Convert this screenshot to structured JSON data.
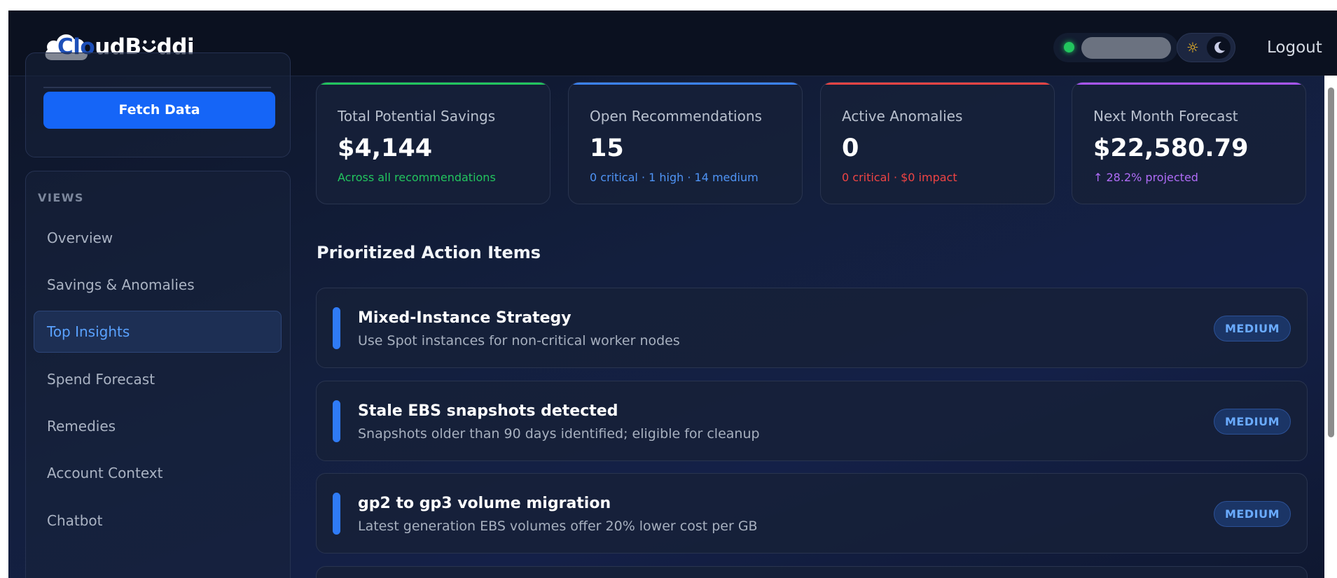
{
  "header": {
    "brand_prefix": "Clo",
    "brand_suffix": "udB",
    "brand_end": "ddi",
    "logout_label": "Logout"
  },
  "sidebar": {
    "fetch_label": "Fetch Data",
    "views_label": "VIEWS",
    "items": [
      {
        "label": "Overview",
        "active": false
      },
      {
        "label": "Savings & Anomalies",
        "active": false
      },
      {
        "label": "Top Insights",
        "active": true
      },
      {
        "label": "Spend Forecast",
        "active": false
      },
      {
        "label": "Remedies",
        "active": false
      },
      {
        "label": "Account Context",
        "active": false
      },
      {
        "label": "Chatbot",
        "active": false
      }
    ]
  },
  "stats": [
    {
      "title": "Total Potential Savings",
      "value": "$4,144",
      "sub": "Across all recommendations",
      "accent": "#22c55e",
      "sub_color": "#22c55e"
    },
    {
      "title": "Open Recommendations",
      "value": "15",
      "sub": "0 critical · 1 high · 14 medium",
      "accent": "#3b82f6",
      "sub_color": "#4f94f6"
    },
    {
      "title": "Active Anomalies",
      "value": "0",
      "sub": "0 critical · $0 impact",
      "accent": "#ef4444",
      "sub_color": "#ef4444"
    },
    {
      "title": "Next Month Forecast",
      "value": "$22,580.79",
      "sub": "↑ 28.2% projected",
      "accent": "#a855f7",
      "sub_color": "#b06cf7"
    }
  ],
  "section": {
    "title": "Prioritized Action Items"
  },
  "actions": [
    {
      "title": "Mixed-Instance Strategy",
      "desc": "Use Spot instances for non-critical worker nodes",
      "badge": "MEDIUM"
    },
    {
      "title": "Stale EBS snapshots detected",
      "desc": "Snapshots older than 90 days identified; eligible for cleanup",
      "badge": "MEDIUM"
    },
    {
      "title": "gp2 to gp3 volume migration",
      "desc": "Latest generation EBS volumes offer 20% lower cost per GB",
      "badge": "MEDIUM"
    }
  ],
  "colors": {
    "accent_blue": "#1565f7",
    "status_online": "#22c55e"
  }
}
